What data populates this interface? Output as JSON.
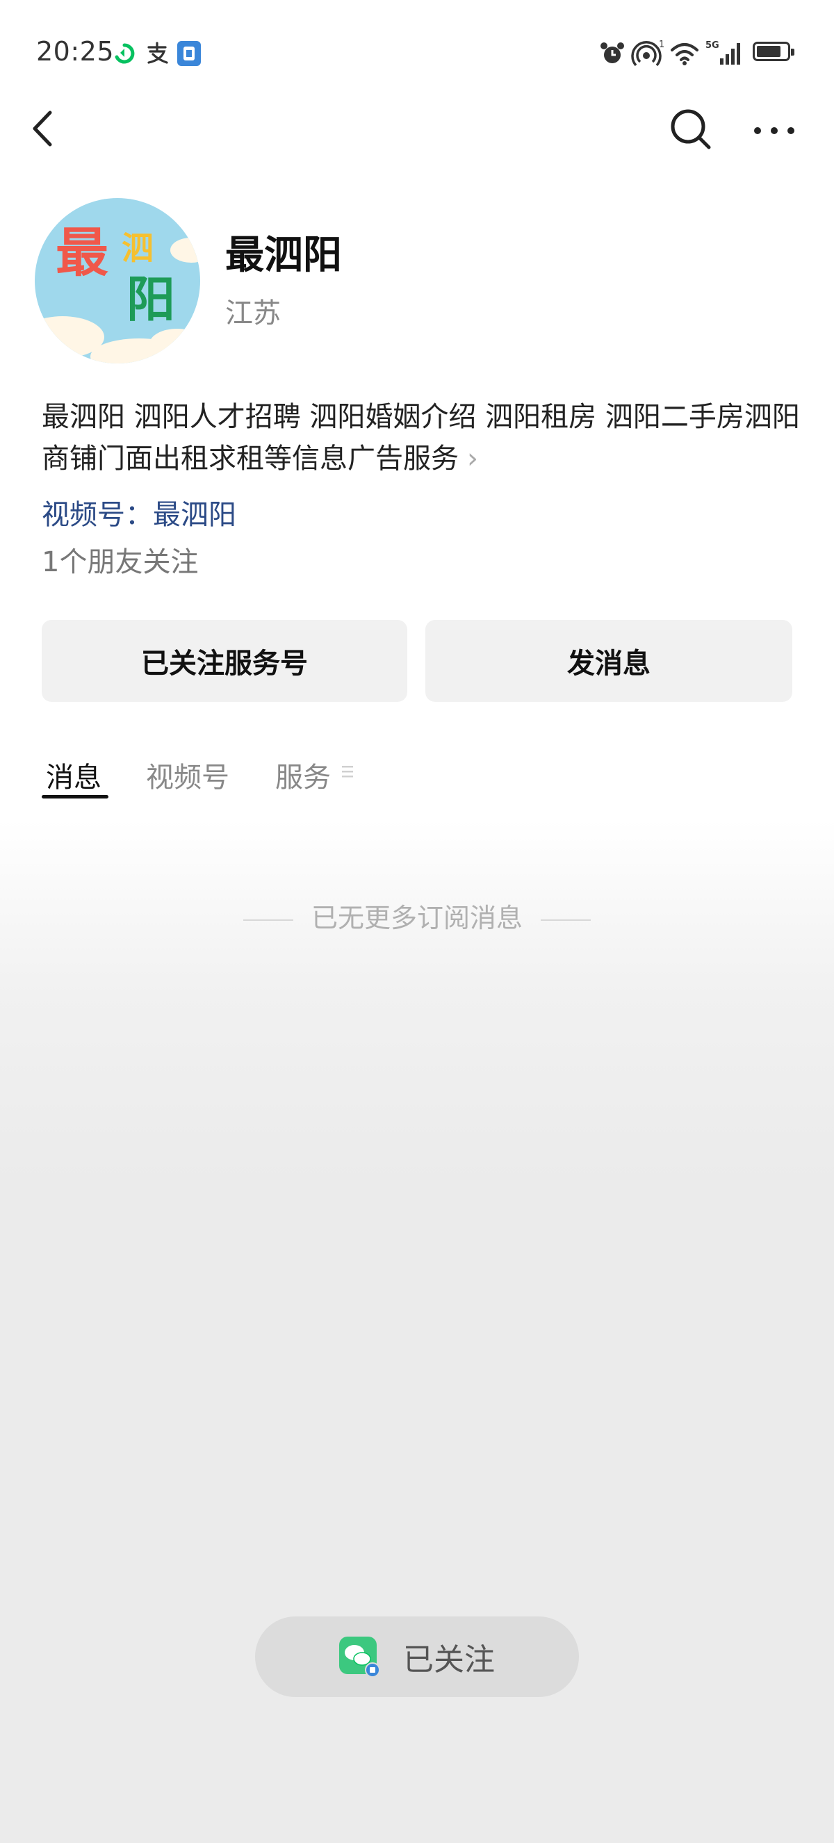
{
  "status_bar": {
    "time": "20:25",
    "icons": [
      "sync-icon",
      "alipay-icon",
      "app-icon",
      "alarm-icon",
      "hotspot-icon",
      "wifi-icon",
      "signal-icon",
      "battery-icon"
    ],
    "signal_label": "5G",
    "hotspot_count": "1"
  },
  "header": {
    "back_icon": "back-arrow-icon",
    "search_icon": "search-icon",
    "more_icon": "more-icon"
  },
  "account": {
    "name": "最泗阳",
    "region": "江苏",
    "avatar_text_1": "最",
    "avatar_text_2": "泗",
    "avatar_text_3": "阳",
    "description": "最泗阳 泗阳人才招聘 泗阳婚姻介绍 泗阳租房 泗阳二手房泗阳商铺门面出租求租等信息广告服务",
    "channel_label": "视频号：最泗阳",
    "friends_following": "1个朋友关注"
  },
  "actions": {
    "followed_label": "已关注服务号",
    "message_label": "发消息"
  },
  "tabs": [
    {
      "label": "消息",
      "active": true
    },
    {
      "label": "视频号",
      "active": false
    },
    {
      "label": "服务",
      "active": false
    }
  ],
  "empty_state": "已无更多订阅消息",
  "bottom_pill": {
    "label": "已关注"
  },
  "colors": {
    "link": "#2b4a86",
    "accent_green": "#07c160"
  }
}
